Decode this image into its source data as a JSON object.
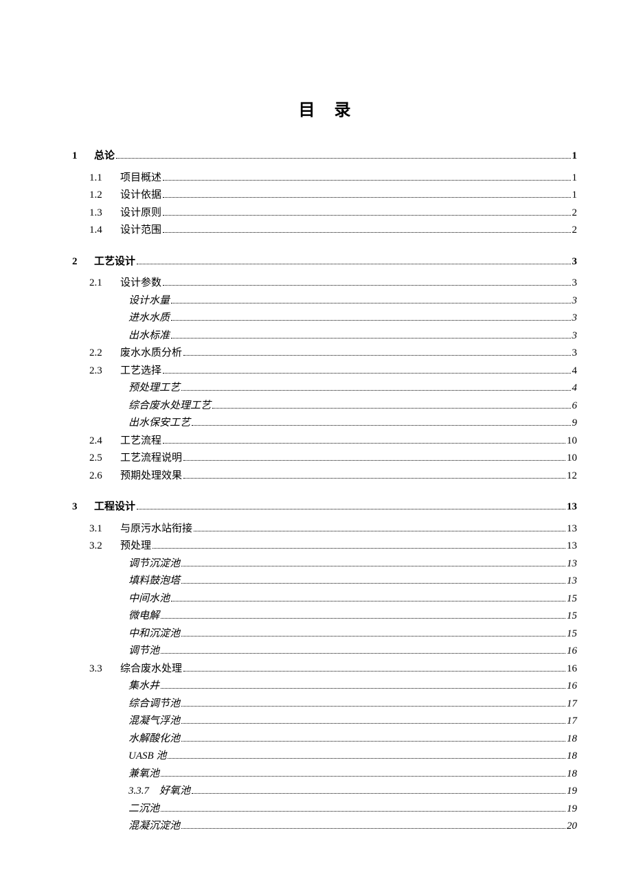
{
  "title": "目录",
  "toc": [
    {
      "level": 0,
      "num": "1",
      "label": "总论",
      "page": "1"
    },
    {
      "level": 1,
      "num": "1.1",
      "label": "项目概述",
      "page": "1"
    },
    {
      "level": 1,
      "num": "1.2",
      "label": "设计依据",
      "page": "1"
    },
    {
      "level": 1,
      "num": "1.3",
      "label": "设计原则",
      "page": "2"
    },
    {
      "level": 1,
      "num": "1.4",
      "label": "设计范围",
      "page": "2"
    },
    {
      "level": 0,
      "num": "2",
      "label": "工艺设计",
      "page": "3"
    },
    {
      "level": 1,
      "num": "2.1",
      "label": "设计参数",
      "page": "3"
    },
    {
      "level": 2,
      "num": "",
      "label": "设计水量",
      "page": "3"
    },
    {
      "level": 2,
      "num": "",
      "label": "进水水质",
      "page": "3"
    },
    {
      "level": 2,
      "num": "",
      "label": "出水标准",
      "page": "3"
    },
    {
      "level": 1,
      "num": "2.2",
      "label": "废水水质分析",
      "page": "3"
    },
    {
      "level": 1,
      "num": "2.3",
      "label": "工艺选择",
      "page": "4"
    },
    {
      "level": 2,
      "num": "",
      "label": "预处理工艺",
      "page": "4"
    },
    {
      "level": 2,
      "num": "",
      "label": "综合废水处理工艺",
      "page": "6"
    },
    {
      "level": 2,
      "num": "",
      "label": "出水保安工艺",
      "page": "9"
    },
    {
      "level": 1,
      "num": "2.4",
      "label": "工艺流程",
      "page": "10"
    },
    {
      "level": 1,
      "num": "2.5",
      "label": "工艺流程说明",
      "page": "10"
    },
    {
      "level": 1,
      "num": "2.6",
      "label": "预期处理效果",
      "page": "12"
    },
    {
      "level": 0,
      "num": "3",
      "label": "工程设计",
      "page": "13"
    },
    {
      "level": 1,
      "num": "3.1",
      "label": "与原污水站衔接",
      "page": "13"
    },
    {
      "level": 1,
      "num": "3.2",
      "label": "预处理",
      "page": "13"
    },
    {
      "level": 2,
      "num": "",
      "label": "调节沉淀池",
      "page": "13"
    },
    {
      "level": 2,
      "num": "",
      "label": "填料鼓泡塔",
      "page": "13"
    },
    {
      "level": 2,
      "num": "",
      "label": "中间水池",
      "page": "15"
    },
    {
      "level": 2,
      "num": "",
      "label": "微电解",
      "page": "15"
    },
    {
      "level": 2,
      "num": "",
      "label": "中和沉淀池",
      "page": "15"
    },
    {
      "level": 2,
      "num": "",
      "label": "调节池",
      "page": "16"
    },
    {
      "level": 1,
      "num": "3.3",
      "label": "综合废水处理",
      "page": "16"
    },
    {
      "level": 2,
      "num": "",
      "label": "集水井",
      "page": "16"
    },
    {
      "level": 2,
      "num": "",
      "label": "综合调节池",
      "page": "17"
    },
    {
      "level": 2,
      "num": "",
      "label": "混凝气浮池",
      "page": "17"
    },
    {
      "level": 2,
      "num": "",
      "label": "水解酸化池",
      "page": "18"
    },
    {
      "level": 2,
      "num": "",
      "label": "UASB 池",
      "page": "18"
    },
    {
      "level": 2,
      "num": "",
      "label": "兼氧池",
      "page": "18"
    },
    {
      "level": 2,
      "num": "3.3.7",
      "label": "好氧池",
      "page": "19"
    },
    {
      "level": 2,
      "num": "",
      "label": "二沉池",
      "page": "19"
    },
    {
      "level": 2,
      "num": "",
      "label": "混凝沉淀池",
      "page": "20"
    }
  ]
}
